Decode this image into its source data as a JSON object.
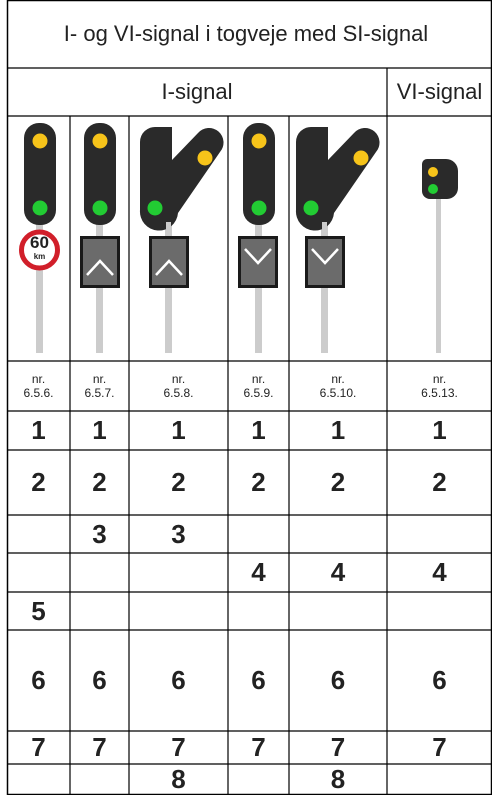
{
  "title": "I- og VI-signal i togveje med SI-signal",
  "groups": [
    {
      "label": "I-signal"
    },
    {
      "label": "VI-signal"
    }
  ],
  "columns": [
    {
      "ref_line1": "nr.",
      "ref_line2": "6.5.6.",
      "speed_sign": {
        "value": "60",
        "unit": "km"
      }
    },
    {
      "ref_line1": "nr.",
      "ref_line2": "6.5.7."
    },
    {
      "ref_line1": "nr.",
      "ref_line2": "6.5.8."
    },
    {
      "ref_line1": "nr.",
      "ref_line2": "6.5.9."
    },
    {
      "ref_line1": "nr.",
      "ref_line2": "6.5.10."
    },
    {
      "ref_line1": "nr.",
      "ref_line2": "6.5.13."
    }
  ],
  "rows": [
    [
      "1",
      "1",
      "1",
      "1",
      "1",
      "1"
    ],
    [
      "2",
      "2",
      "2",
      "2",
      "2",
      "2"
    ],
    [
      "",
      "3",
      "3",
      "",
      "",
      ""
    ],
    [
      "",
      "",
      "",
      "4",
      "4",
      "4"
    ],
    [
      "5",
      "",
      "",
      "",
      "",
      ""
    ],
    [
      "6",
      "6",
      "6",
      "6",
      "6",
      "6"
    ],
    [
      "7",
      "7",
      "7",
      "7",
      "7",
      "7"
    ],
    [
      "",
      "",
      "8",
      "",
      "8",
      ""
    ]
  ],
  "colors": {
    "signal_body": "#2a2a2a",
    "lamp_yellow": "#f7c41a",
    "lamp_green": "#22cc33",
    "mast": "#cccccc",
    "indicator_panel": "#6b6b6b",
    "speed_ring": "#d11f2a"
  }
}
